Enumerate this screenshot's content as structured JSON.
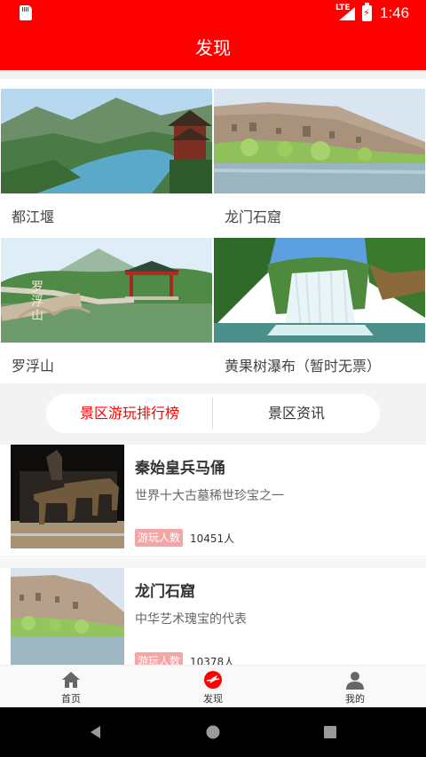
{
  "status_bar": {
    "network": "LTE",
    "time": "1:46",
    "icons": [
      "sd-card-icon",
      "signal-icon",
      "battery-charging-icon"
    ]
  },
  "header": {
    "title": "发现"
  },
  "scenic_grid": {
    "items": [
      {
        "name": "都江堰"
      },
      {
        "name": "龙门石窟"
      },
      {
        "name": "罗浮山"
      },
      {
        "name": "黄果树瀑布（暂时无票）"
      }
    ]
  },
  "tabs": {
    "items": [
      {
        "label": "景区游玩排行榜",
        "active": true
      },
      {
        "label": "景区资讯",
        "active": false
      }
    ],
    "active_color": "#ff0000"
  },
  "ranking": {
    "badge_label": "游玩人数",
    "items": [
      {
        "title": "秦始皇兵马俑",
        "desc": "世界十大古墓稀世珍宝之一",
        "count": "10451人"
      },
      {
        "title": "龙门石窟",
        "desc": "中华艺术瑰宝的代表",
        "count": "10378人"
      }
    ]
  },
  "bottom_nav": {
    "items": [
      {
        "label": "首页",
        "icon": "home-icon"
      },
      {
        "label": "发现",
        "icon": "discover-icon",
        "active": true
      },
      {
        "label": "我的",
        "icon": "profile-icon"
      }
    ]
  },
  "colors": {
    "brand": "#ff0000",
    "badge": "#f6a5a5"
  }
}
